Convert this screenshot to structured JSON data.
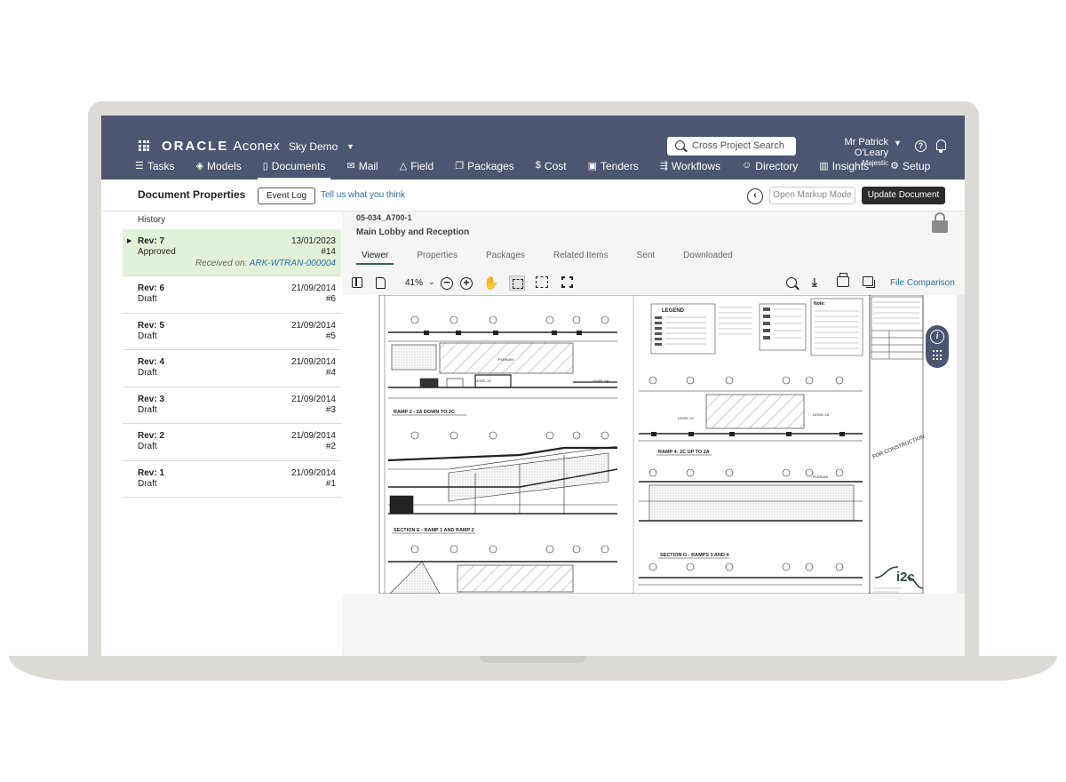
{
  "header": {
    "brand_oracle": "ORACLE",
    "brand_aconex": "Aconex",
    "project": "Sky Demo",
    "search_placeholder": "Cross Project Search",
    "user_name": "Mr Patrick O'Leary",
    "user_org": "Majestic"
  },
  "nav": [
    {
      "label": "Tasks",
      "icon": "tasks-icon"
    },
    {
      "label": "Models",
      "icon": "cube-icon"
    },
    {
      "label": "Documents",
      "icon": "document-icon"
    },
    {
      "label": "Mail",
      "icon": "mail-icon"
    },
    {
      "label": "Field",
      "icon": "warning-triangle-icon"
    },
    {
      "label": "Packages",
      "icon": "packages-icon"
    },
    {
      "label": "Cost",
      "icon": "dollar-icon"
    },
    {
      "label": "Tenders",
      "icon": "tenders-icon"
    },
    {
      "label": "Workflows",
      "icon": "workflow-icon"
    },
    {
      "label": "Directory",
      "icon": "people-icon"
    },
    {
      "label": "Insights",
      "icon": "chart-icon"
    },
    {
      "label": "Setup",
      "icon": "gear-icon"
    }
  ],
  "subheader": {
    "title": "Document Properties",
    "event_log": "Event Log",
    "tell_us": "Tell us what you think",
    "open_markup": "Open Markup Mode",
    "update_document": "Update Document"
  },
  "sidebar": {
    "history_label": "History",
    "revisions": [
      {
        "rev": "Rev: 7",
        "status": "Approved",
        "date": "13/01/2023",
        "num": "#14",
        "received_prefix": "Received on:",
        "received_id": "ARK-WTRAN-000004"
      },
      {
        "rev": "Rev: 6",
        "status": "Draft",
        "date": "21/09/2014",
        "num": "#6"
      },
      {
        "rev": "Rev: 5",
        "status": "Draft",
        "date": "21/09/2014",
        "num": "#5"
      },
      {
        "rev": "Rev: 4",
        "status": "Draft",
        "date": "21/09/2014",
        "num": "#4"
      },
      {
        "rev": "Rev: 3",
        "status": "Draft",
        "date": "21/09/2014",
        "num": "#3"
      },
      {
        "rev": "Rev: 2",
        "status": "Draft",
        "date": "21/09/2014",
        "num": "#2"
      },
      {
        "rev": "Rev: 1",
        "status": "Draft",
        "date": "21/09/2014",
        "num": "#1"
      }
    ]
  },
  "document": {
    "number": "05-034_A700-1",
    "name": "Main Lobby and Reception",
    "tabs": [
      "Viewer",
      "Properties",
      "Packages",
      "Related Items",
      "Sent",
      "Downloaded"
    ],
    "active_tab": "Viewer"
  },
  "toolbar": {
    "zoom": "41%",
    "file_comparison": "File Comparison"
  },
  "drawing_labels": {
    "ramp2": "RAMP 2 - 2A DOWN TO 2C",
    "ramp4": "RAMP 4- 2C UP TO 2A",
    "section_e": "SECTION E - RAMP 1 AND RAMP 2",
    "section_g": "SECTION G - RAMPS 3 AND 4",
    "legend": "LEGEND",
    "notes": "Note:",
    "for_construction": "FOR CONSTRUCTION",
    "level_2c": "LEVEL 2C",
    "level_2a": "LEVEL 2A",
    "plenum": "PLENUM",
    "logo": "i2c"
  }
}
